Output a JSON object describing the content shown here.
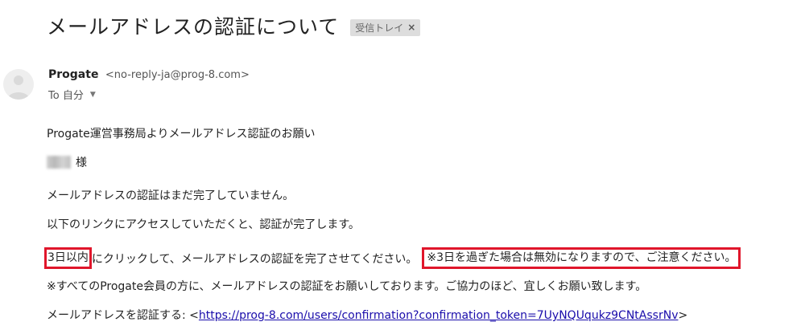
{
  "email": {
    "subject": "メールアドレスの認証について",
    "label": "受信トレイ",
    "label_close": "×",
    "sender_name": "Progate",
    "sender_email": "<no-reply-ja@prog-8.com>",
    "to_label": "To 自分",
    "body": {
      "line1": "Progate運営事務局よりメールアドレス認証のお願い",
      "honorific": "様",
      "line3": "メールアドレスの認証はまだ完了していません。",
      "line4": "以下のリンクにアクセスしていただくと、認証が完了します。",
      "line5_boxed": "3日以内",
      "line5_rest": "にクリックして、メールアドレスの認証を完了させてください。",
      "line5_warning": "※3日を過ぎた場合は無効になりますので、ご注意ください。",
      "line6": "※すべてのProgate会員の方に、メールアドレスの認証をお願いしております。ご協力のほど、宜しくお願い致します。",
      "link_prefix": "メールアドレスを認証する: <",
      "link_text": "https://prog-8.com/users/confirmation?confirmation_token=7UyNQUqukz9CNtAssrNv",
      "link_suffix": ">"
    }
  },
  "colors": {
    "highlight_box": "#e0162b",
    "link": "#1a0dab",
    "chip_bg": "#dddddd"
  },
  "icons": {
    "avatar": "default-person-avatar",
    "caret": "caret-down-icon"
  }
}
